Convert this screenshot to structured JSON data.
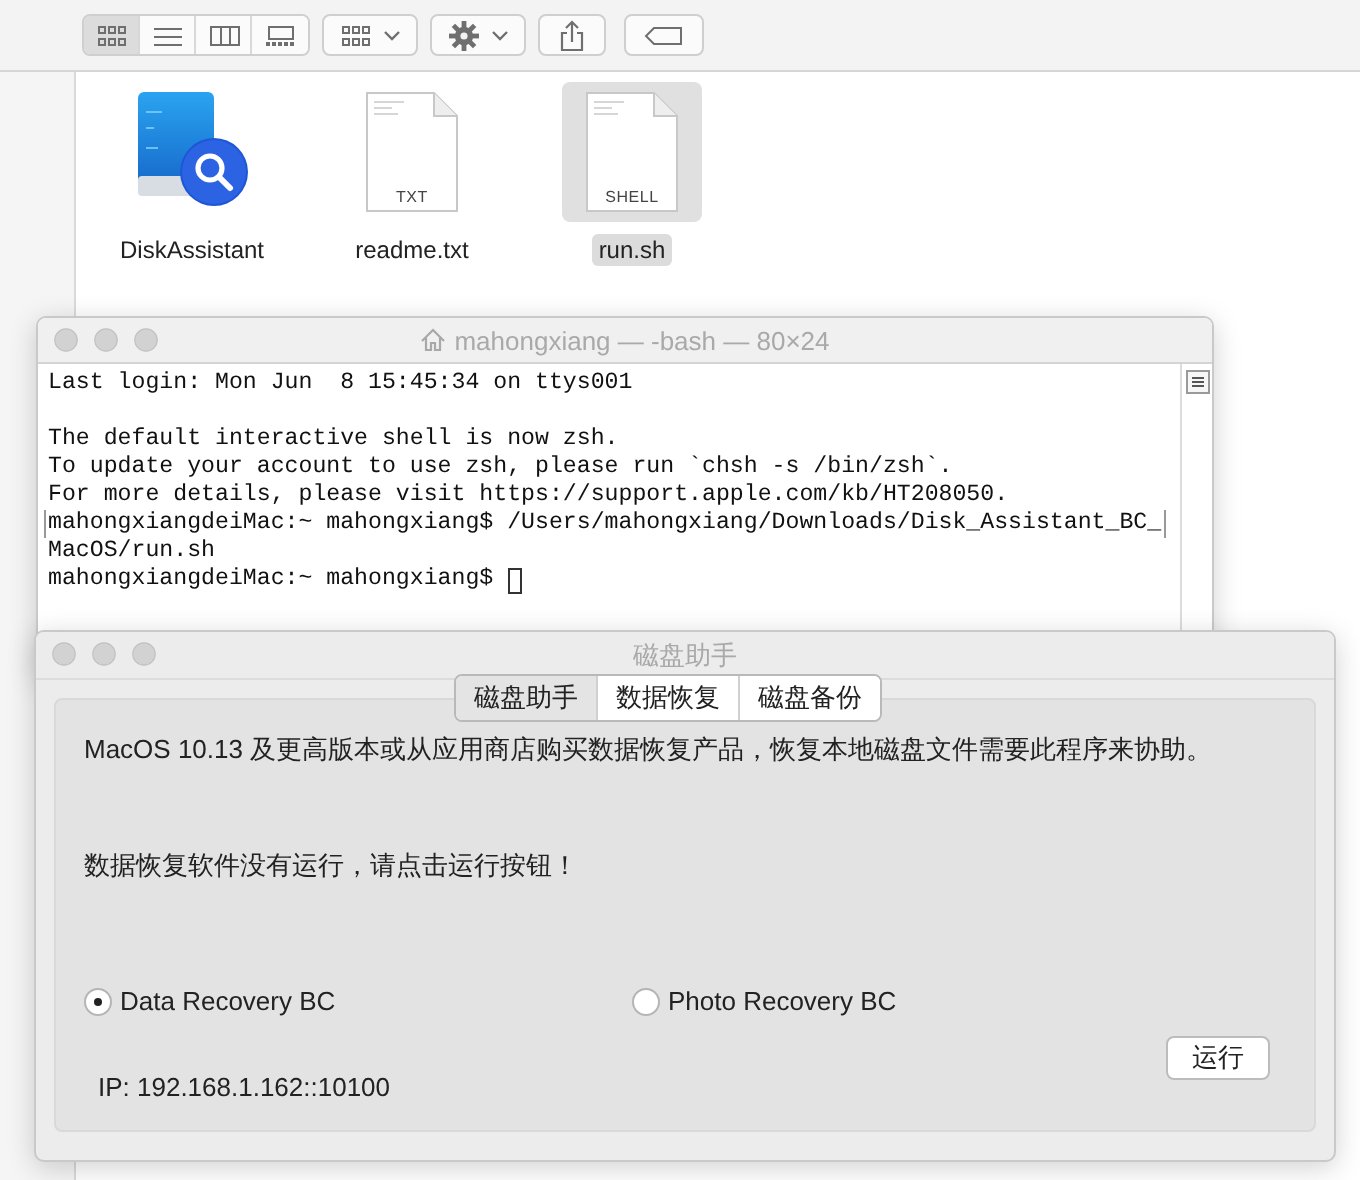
{
  "finder": {
    "view_modes": [
      {
        "kind": "icon",
        "selected": true
      },
      {
        "kind": "list",
        "selected": false
      },
      {
        "kind": "column",
        "selected": false
      },
      {
        "kind": "gallery",
        "selected": false
      }
    ],
    "files": [
      {
        "name": "DiskAssistant",
        "kind": "app",
        "selected": false
      },
      {
        "name": "readme.txt",
        "kind": "document",
        "badge": "TXT",
        "selected": false
      },
      {
        "name": "run.sh",
        "kind": "document",
        "badge": "SHELL",
        "selected": true
      }
    ]
  },
  "terminal": {
    "title": "mahongxiang — -bash — 80×24",
    "lines": [
      {
        "kind": "text",
        "text": "Last login: Mon Jun  8 15:45:34 on ttys001"
      },
      {
        "kind": "blank"
      },
      {
        "kind": "text",
        "text": "The default interactive shell is now zsh."
      },
      {
        "kind": "text",
        "text": "To update your account to use zsh, please run `chsh -s /bin/zsh`."
      },
      {
        "kind": "text",
        "text": "For more details, please visit https://support.apple.com/kb/HT208050."
      },
      {
        "kind": "marked",
        "text": "mahongxiangdeiMac:~ mahongxiang$ /Users/mahongxiang/Downloads/Disk_Assistant_BC_"
      },
      {
        "kind": "text",
        "text": "MacOS/run.sh"
      },
      {
        "kind": "prompt",
        "text": "mahongxiangdeiMac:~ mahongxiang$ "
      }
    ]
  },
  "dialog": {
    "title": "磁盘助手",
    "tabs": [
      {
        "label": "磁盘助手",
        "selected": true
      },
      {
        "label": "数据恢复",
        "selected": false
      },
      {
        "label": "磁盘备份",
        "selected": false
      }
    ],
    "message": "MacOS 10.13 及更高版本或从应用商店购买数据恢复产品，恢复本地磁盘文件需要此程序来协助。",
    "status": "数据恢复软件没有运行，请点击运行按钮！",
    "options": [
      {
        "label": "Data Recovery BC",
        "selected": true
      },
      {
        "label": "Photo Recovery BC",
        "selected": false
      }
    ],
    "ip": "IP: 192.168.1.162::10100",
    "run_button": "运行"
  }
}
